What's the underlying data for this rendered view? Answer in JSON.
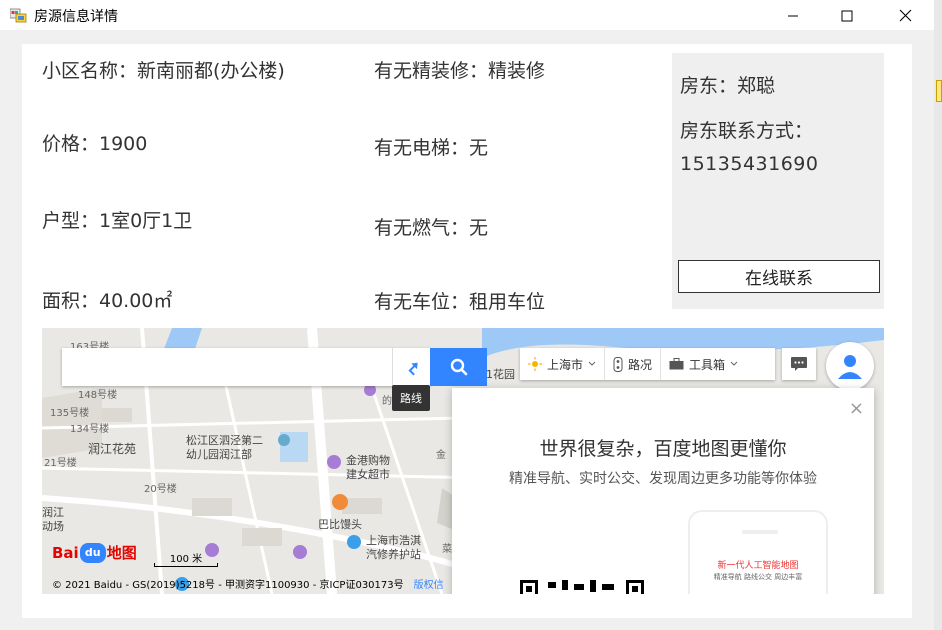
{
  "window": {
    "title": "房源信息详情",
    "minimize": "—",
    "maximize": "☐",
    "close": "✕"
  },
  "details": {
    "community": "小区名称：新南丽都(办公楼)",
    "price": "价格：1900",
    "layout": "户型：1室0厅1卫",
    "area": "面积：40.00㎡",
    "decoration": "有无精装修：精装修",
    "elevator": "有无电梯：无",
    "gas": "有无燃气：无",
    "parking": "有无车位：租用车位"
  },
  "contact": {
    "owner": "房东：郑聪",
    "contact_label": "房东联系方式：",
    "phone": "15135431690",
    "button": "在线联系"
  },
  "map": {
    "search_placeholder": "",
    "route_tooltip": "路线",
    "city": "上海市",
    "traffic": "路况",
    "toolbox": "工具箱",
    "popup": {
      "title": "世界很复杂，百度地图更懂你",
      "subtitle": "精准导航、实时公交、发现周边更多功能等你体验",
      "phone_title": "新一代人工智能地图",
      "phone_sub": "精准导航  路线公交  周边丰富",
      "close": "×"
    },
    "logo_bai": "Bai",
    "logo_du": "du",
    "logo_map": "地图",
    "scale": "100 米",
    "copyright": "© 2021 Baidu - GS(2019)5218号 - 甲测资字1100930 - 京ICP证030173号",
    "copyright_link": "版权信",
    "labels": {
      "l1": "163号楼",
      "l2": "148号楼",
      "l3": "135号楼",
      "l4": "134号楼",
      "l5": "润江花苑",
      "l6": "21号楼",
      "l7": "20号楼",
      "l8": "润江",
      "l9": "动场",
      "l10": "松江区泗泾第二",
      "l11": "幼儿园润江部",
      "l12": "金港购物",
      "l13": "建女超市",
      "l14": "巴比馒头",
      "l15": "上海市浩淇",
      "l16": "汽修养护站",
      "l17": "1花园",
      "l18": "的",
      "l19": "金",
      "l20": "菜"
    }
  }
}
